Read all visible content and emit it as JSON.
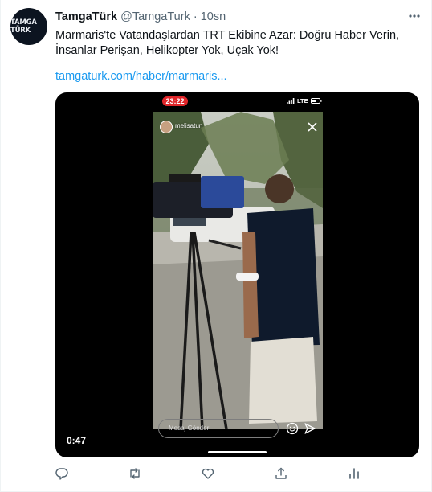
{
  "account": {
    "avatar_text": "TAMGA TÜRK",
    "name": "TamgaTürk",
    "handle": "@TamgaTurk",
    "separator": "·",
    "time": "10sn"
  },
  "tweet": {
    "text": "Marmaris'te Vatandaşlardan TRT Ekibine Azar: Doğru Haber Verin, İnsanlar Perişan, Helikopter Yok, Uçak Yok!",
    "link": "tamgaturk.com/haber/marmaris..."
  },
  "video": {
    "recording_time": "23:22",
    "network": "LTE",
    "story_user": "melisatun",
    "message_placeholder": "Mesaj Gönder",
    "duration": "0:47"
  },
  "icons": {
    "more": "more-icon",
    "reply": "reply-icon",
    "retweet": "retweet-icon",
    "like": "like-icon",
    "share": "share-icon",
    "analytics": "analytics-icon"
  },
  "colors": {
    "link": "#1d9bf0",
    "muted": "#536471",
    "recording": "#e0262a"
  }
}
